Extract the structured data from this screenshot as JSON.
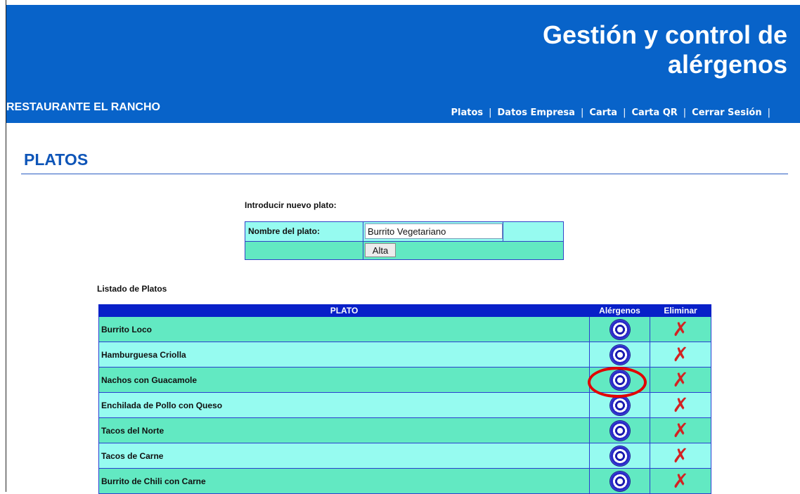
{
  "header": {
    "title": "Gestión y control de alérgenos",
    "company": "RESTAURANTE EL RANCHO",
    "nav": [
      "Platos",
      "Datos Empresa",
      "Carta",
      "Carta QR",
      "Cerrar Sesión"
    ],
    "nav_separator": "|",
    "trailing_separator": "|",
    "background_color": "#0863c9"
  },
  "page": {
    "title": "PLATOS"
  },
  "form": {
    "intro": "Introducir nuevo plato:",
    "name_label": "Nombre del plato:",
    "name_value": "Burrito Vegetariano",
    "submit_label": "Alta"
  },
  "list": {
    "title": "Listado de Platos",
    "columns": [
      "PLATO",
      "Alérgenos",
      "Eliminar"
    ],
    "rows": [
      {
        "name": "Burrito Loco"
      },
      {
        "name": "Hamburguesa Criolla"
      },
      {
        "name": "Nachos con Guacamole"
      },
      {
        "name": "Enchilada de Pollo con Queso"
      },
      {
        "name": "Tacos del Norte"
      },
      {
        "name": "Tacos de Carne"
      },
      {
        "name": "Burrito de Chili con Carne"
      }
    ],
    "allergen_icon": "allergen-target-icon",
    "delete_icon": "delete-x-icon",
    "delete_glyph": "✗",
    "highlighted_row": 3
  }
}
